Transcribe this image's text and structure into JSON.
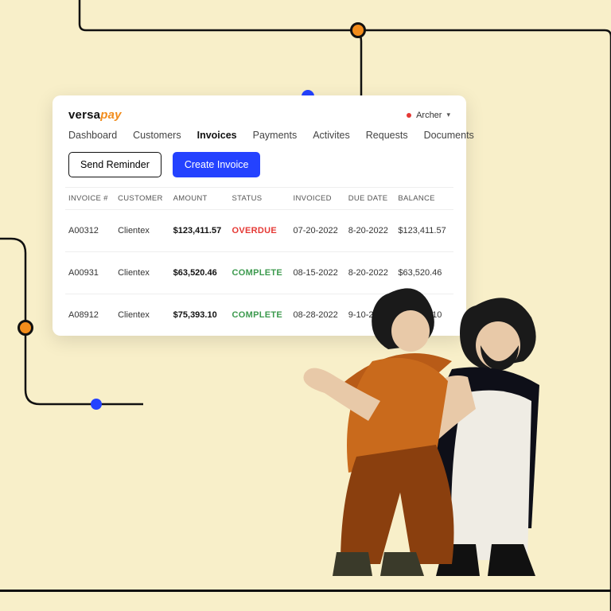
{
  "brand": {
    "part1": "versa",
    "part2": "pay"
  },
  "user": {
    "name": "Archer"
  },
  "nav": {
    "items": [
      {
        "label": "Dashboard"
      },
      {
        "label": "Customers"
      },
      {
        "label": "Invoices",
        "active": true
      },
      {
        "label": "Payments"
      },
      {
        "label": "Activites"
      },
      {
        "label": "Requests"
      },
      {
        "label": "Documents"
      }
    ]
  },
  "actions": {
    "secondary": "Send Reminder",
    "primary": "Create Invoice"
  },
  "table": {
    "headers": {
      "invoice": "INVOICE #",
      "customer": "CUSTOMER",
      "amount": "AMOUNT",
      "status": "STATUS",
      "invoiced": "INVOICED",
      "due": "DUE DATE",
      "balance": "BALANCE"
    },
    "rows": [
      {
        "invoice": "A00312",
        "customer": "Clientex",
        "amount": "$123,411.57",
        "status": "OVERDUE",
        "invoiced": "07-20-2022",
        "due": "8-20-2022",
        "balance": "$123,411.57"
      },
      {
        "invoice": "A00931",
        "customer": "Clientex",
        "amount": "$63,520.46",
        "status": "COMPLETE",
        "invoiced": "08-15-2022",
        "due": "8-20-2022",
        "balance": "$63,520.46"
      },
      {
        "invoice": "A08912",
        "customer": "Clientex",
        "amount": "$75,393.10",
        "status": "COMPLETE",
        "invoiced": "08-28-2022",
        "due": "9-10-2022",
        "balance": "$75,393.10"
      }
    ]
  }
}
